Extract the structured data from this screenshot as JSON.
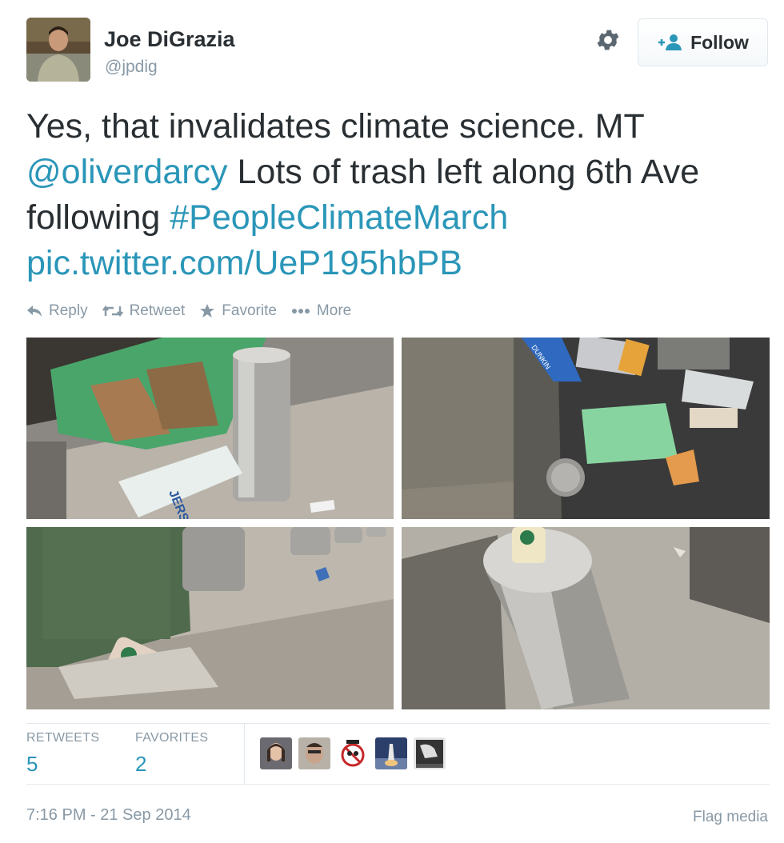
{
  "user": {
    "name": "Joe DiGrazia",
    "handle": "@jpdig"
  },
  "follow_button": {
    "label": "Follow",
    "icon": "add-user-icon"
  },
  "settings_icon": "gear-icon",
  "tweet": {
    "text_1": "Yes, that invalidates climate science. MT ",
    "mention": "@oliverdarcy",
    "text_2": " Lots of trash left along 6th Ave following ",
    "hashtag": "#PeopleClimateMarch",
    "pic_link": "pic.twitter.com/UeP195hbPB",
    "link_color": "#2a96b8"
  },
  "actions": [
    {
      "label": "Reply",
      "icon": "reply-icon"
    },
    {
      "label": "Retweet",
      "icon": "retweet-icon"
    },
    {
      "label": "Favorite",
      "icon": "star-icon"
    },
    {
      "label": "More",
      "icon": "more-dots-icon"
    }
  ],
  "photos": {
    "top_left_sign": "JERSEY SHORE",
    "top_right_wrapper": "DUNKIN"
  },
  "stats": {
    "retweets_label": "RETWEETS",
    "retweets": "5",
    "favorites_label": "FAVORITES",
    "favorites": "2"
  },
  "timestamp": "7:16 PM - 21 Sep 2014",
  "flag_media": "Flag media"
}
